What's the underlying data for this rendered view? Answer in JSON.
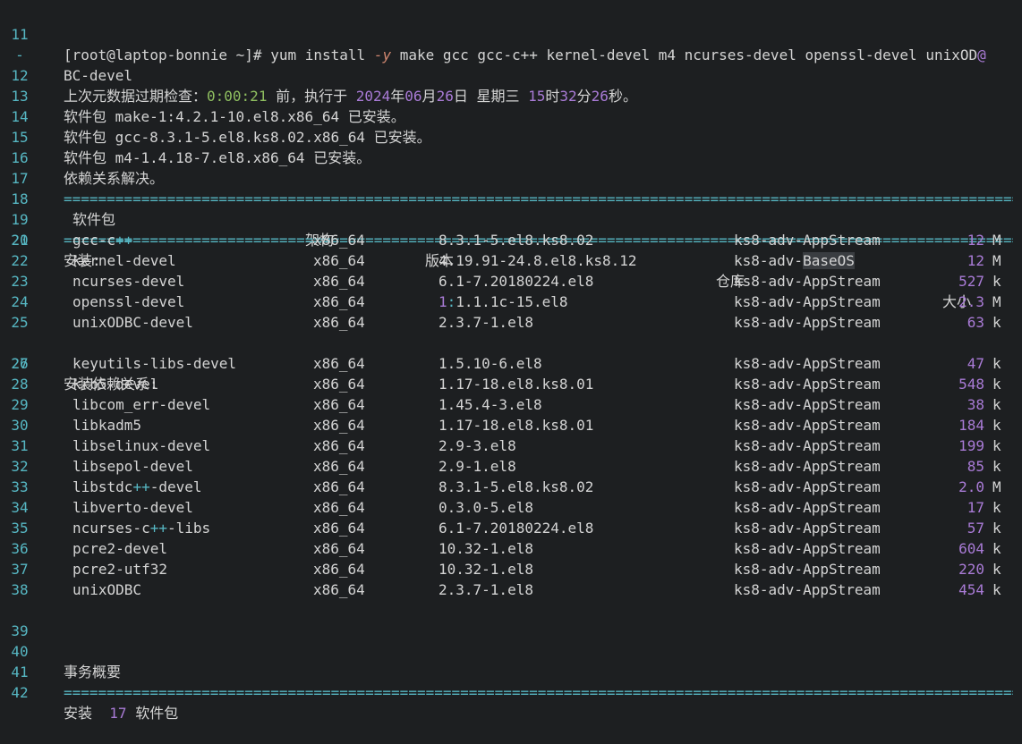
{
  "colors": {
    "background": "#1d1f21",
    "line_number": "#56b6c2",
    "number": "#a97bd6",
    "separator": "#56b6c2"
  },
  "lines": {
    "l11": {
      "num": "11",
      "prompt": "[root@laptop-bonnie ~]#",
      "cmd": "yum install",
      "flag": "-y",
      "rest": "make gcc gcc-c++ kernel-devel m4 ncurses-devel openssl-devel unixOD",
      "wrap_marker": "@"
    },
    "l11b": {
      "num": "-",
      "text": "BC-devel"
    },
    "l12": {
      "num": "12",
      "p1": "上次元数据过期检查：",
      "time": "0:00:21",
      "p2": " 前，执行于 ",
      "year": "2024",
      "t_year": "年",
      "month": "06",
      "t_month": "月",
      "day": "26",
      "t_day": "日 星期三 ",
      "hour": "15",
      "t_hour": "时",
      "min": "32",
      "t_min": "分",
      "sec": "26",
      "t_sec": "秒。"
    },
    "l13": {
      "num": "13",
      "text": "软件包 make-1:4.2.1-10.el8.x86_64 已安装。"
    },
    "l14": {
      "num": "14",
      "text": "软件包 gcc-8.3.1-5.el8.ks8.02.x86_64 已安装。"
    },
    "l15": {
      "num": "15",
      "text": "软件包 m4-1.4.18-7.el8.x86_64 已安装。"
    },
    "l16": {
      "num": "16",
      "text": "依赖关系解决。"
    },
    "l17": {
      "num": "17"
    },
    "l18": {
      "num": "18",
      "col_pkg": "软件包",
      "col_arch": "架构",
      "col_ver": "版本",
      "col_repo": "仓库",
      "col_size": "大小"
    },
    "l19": {
      "num": "19"
    },
    "l20": {
      "num": "20",
      "text": "安装:"
    },
    "l26": {
      "num": "26",
      "text": "安装依赖关系:"
    },
    "l39": {
      "num": "39"
    },
    "l40": {
      "num": "40",
      "text": "事务概要"
    },
    "l41": {
      "num": "41"
    },
    "l42": {
      "num": "42",
      "label": "安装",
      "count": "17",
      "suffix": "软件包"
    }
  },
  "separator": "====================================================================================================================================",
  "install_rows": [
    {
      "num": "21",
      "pkg": "gcc-c++",
      "arch": "x86_64",
      "ver": "8.3.1-5.el8.ks8.02",
      "repo": "ks8-adv-AppStream",
      "size": "12",
      "unit": "M"
    },
    {
      "num": "22",
      "pkg": "kernel-devel",
      "arch": "x86_64",
      "ver": "4.19.91-24.8.el8.ks8.12",
      "repo": "ks8-adv-BaseOS",
      "size": "12",
      "unit": "M"
    },
    {
      "num": "23",
      "pkg": "ncurses-devel",
      "arch": "x86_64",
      "ver": "6.1-7.20180224.el8",
      "repo": "ks8-adv-AppStream",
      "size": "527",
      "unit": "k"
    },
    {
      "num": "24",
      "pkg": "openssl-devel",
      "arch": "x86_64",
      "ver": "1:1.1.1c-15.el8",
      "repo": "ks8-adv-AppStream",
      "size": "2.3",
      "unit": "M"
    },
    {
      "num": "25",
      "pkg": "unixODBC-devel",
      "arch": "x86_64",
      "ver": "2.3.7-1.el8",
      "repo": "ks8-adv-AppStream",
      "size": "63",
      "unit": "k"
    }
  ],
  "dep_rows": [
    {
      "num": "27",
      "pkg": "keyutils-libs-devel",
      "arch": "x86_64",
      "ver": "1.5.10-6.el8",
      "repo": "ks8-adv-AppStream",
      "size": "47",
      "unit": "k"
    },
    {
      "num": "28",
      "pkg": "krb5-devel",
      "arch": "x86_64",
      "ver": "1.17-18.el8.ks8.01",
      "repo": "ks8-adv-AppStream",
      "size": "548",
      "unit": "k"
    },
    {
      "num": "29",
      "pkg": "libcom_err-devel",
      "arch": "x86_64",
      "ver": "1.45.4-3.el8",
      "repo": "ks8-adv-AppStream",
      "size": "38",
      "unit": "k"
    },
    {
      "num": "30",
      "pkg": "libkadm5",
      "arch": "x86_64",
      "ver": "1.17-18.el8.ks8.01",
      "repo": "ks8-adv-AppStream",
      "size": "184",
      "unit": "k"
    },
    {
      "num": "31",
      "pkg": "libselinux-devel",
      "arch": "x86_64",
      "ver": "2.9-3.el8",
      "repo": "ks8-adv-AppStream",
      "size": "199",
      "unit": "k"
    },
    {
      "num": "32",
      "pkg": "libsepol-devel",
      "arch": "x86_64",
      "ver": "2.9-1.el8",
      "repo": "ks8-adv-AppStream",
      "size": "85",
      "unit": "k"
    },
    {
      "num": "33",
      "pkg": "libstdc++-devel",
      "arch": "x86_64",
      "ver": "8.3.1-5.el8.ks8.02",
      "repo": "ks8-adv-AppStream",
      "size": "2.0",
      "unit": "M"
    },
    {
      "num": "34",
      "pkg": "libverto-devel",
      "arch": "x86_64",
      "ver": "0.3.0-5.el8",
      "repo": "ks8-adv-AppStream",
      "size": "17",
      "unit": "k"
    },
    {
      "num": "35",
      "pkg": "ncurses-c++-libs",
      "arch": "x86_64",
      "ver": "6.1-7.20180224.el8",
      "repo": "ks8-adv-AppStream",
      "size": "57",
      "unit": "k"
    },
    {
      "num": "36",
      "pkg": "pcre2-devel",
      "arch": "x86_64",
      "ver": "10.32-1.el8",
      "repo": "ks8-adv-AppStream",
      "size": "604",
      "unit": "k"
    },
    {
      "num": "37",
      "pkg": "pcre2-utf32",
      "arch": "x86_64",
      "ver": "10.32-1.el8",
      "repo": "ks8-adv-AppStream",
      "size": "220",
      "unit": "k"
    },
    {
      "num": "38",
      "pkg": "unixODBC",
      "arch": "x86_64",
      "ver": "2.3.7-1.el8",
      "repo": "ks8-adv-AppStream",
      "size": "454",
      "unit": "k"
    }
  ]
}
